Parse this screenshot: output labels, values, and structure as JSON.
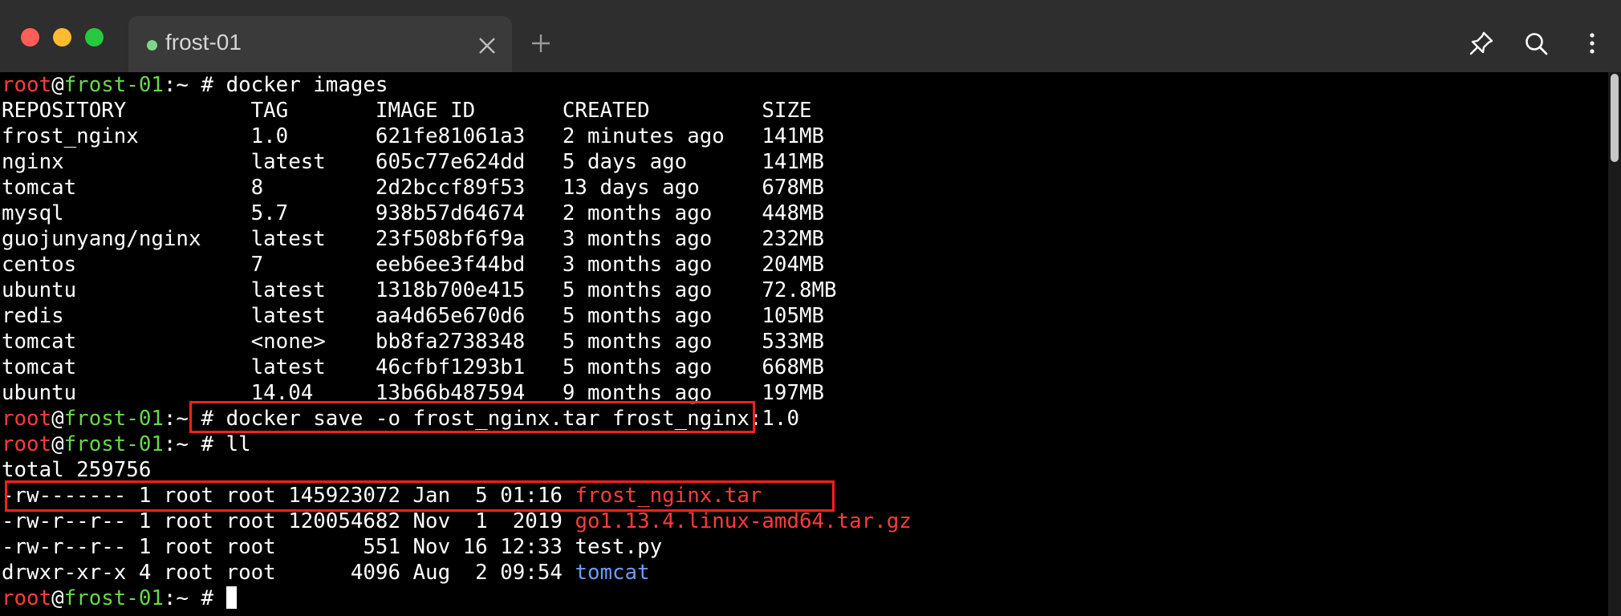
{
  "window": {
    "tab_title": "frost-01"
  },
  "prompt": {
    "user": "root",
    "at": "@",
    "host": "frost-01",
    "sep_path": ":~ # "
  },
  "commands": {
    "images": "docker images",
    "save": "docker save -o frost_nginx.tar frost_nginx:1.0",
    "ll": "ll"
  },
  "images_table": {
    "header": "REPOSITORY          TAG       IMAGE ID       CREATED         SIZE",
    "rows": [
      "frost_nginx         1.0       621fe81061a3   2 minutes ago   141MB",
      "nginx               latest    605c77e624dd   5 days ago      141MB",
      "tomcat              8         2d2bccf89f53   13 days ago     678MB",
      "mysql               5.7       938b57d64674   2 months ago    448MB",
      "guojunyang/nginx    latest    23f508bf6f9a   3 months ago    232MB",
      "centos              7         eeb6ee3f44bd   3 months ago    204MB",
      "ubuntu              latest    1318b700e415   5 months ago    72.8MB",
      "redis               latest    aa4d65e670d6   5 months ago    105MB",
      "tomcat              <none>    bb8fa2738348   5 months ago    533MB",
      "tomcat              latest    46cfbf1293b1   5 months ago    668MB",
      "ubuntu              14.04     13b66b487594   9 months ago    197MB"
    ]
  },
  "ls": {
    "total": "total 259756",
    "entries": [
      {
        "meta": "-rw------- 1 root root 145923072 Jan  5 01:16 ",
        "name": "frost_nginx.tar"
      },
      {
        "meta": "-rw-r--r-- 1 root root 120054682 Nov  1  2019 ",
        "name": "go1.13.4.linux-amd64.tar.gz"
      },
      {
        "meta": "-rw-r--r-- 1 root root       551 Nov 16 12:33 ",
        "name": "test.py"
      },
      {
        "meta": "drwxr-xr-x 4 root root      4096 Aug  2 09:54 ",
        "name": "tomcat"
      }
    ]
  },
  "colors": {
    "prompt_user": "#ff3b3b",
    "prompt_host": "#68d84a",
    "archive_file": "#ff3b3b",
    "directory": "#6a9df4",
    "highlight_box": "#ff1f1f"
  },
  "icons": {
    "tab_close": "close-icon",
    "new_tab": "plus-icon",
    "pin": "pin-icon",
    "search": "search-icon",
    "more": "more-vertical-icon"
  }
}
